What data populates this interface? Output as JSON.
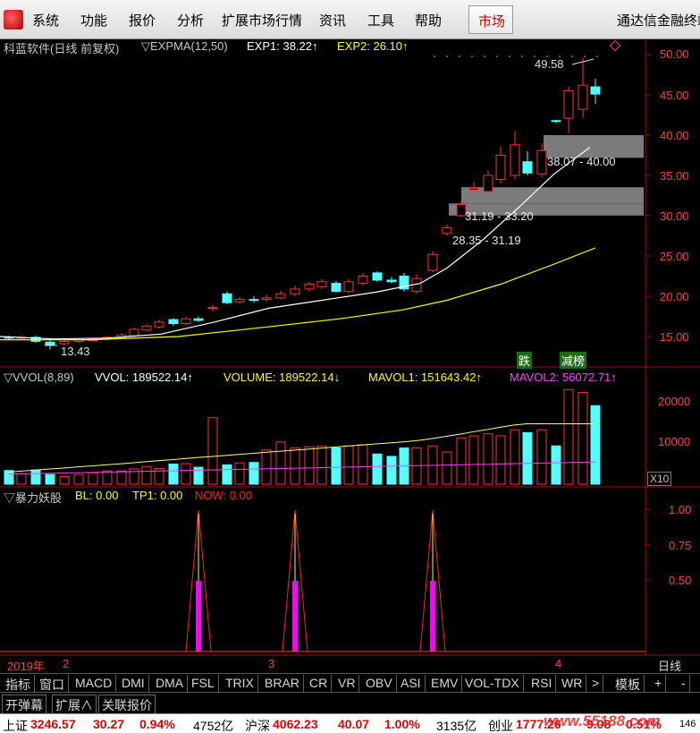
{
  "menu": {
    "items": [
      "系统",
      "功能",
      "报价",
      "分析",
      "扩展市场行情",
      "资讯",
      "工具",
      "帮助"
    ],
    "market_label": "市场",
    "brand": "通达信金融终端"
  },
  "main_panel": {
    "title": "科蓝软件(日线 前复权)",
    "indicator": "▽EXPMA(12,50)",
    "exp1": "EXP1: 38.22↑",
    "exp2": "EXP2: 26.10↑",
    "price_high_label": "49.58",
    "price_low_label": "13.43",
    "zone_labels": [
      "38.07 - 40.00",
      "31.19 - 33.20",
      "28.35 - 31.19"
    ],
    "tags": {
      "down": "跌",
      "reduce": "减榜"
    },
    "y_ticks": [
      "50.00",
      "45.00",
      "40.00",
      "35.00",
      "30.00",
      "25.00",
      "20.00",
      "15.00"
    ],
    "colors": {
      "up": "#ff3232",
      "down": "#54ffff",
      "exp1": "#ffffff",
      "exp2": "#ffff00"
    }
  },
  "vol_panel": {
    "indicator": "▽VVOL(8,89)",
    "vvol": "VVOL: 189522.14↑",
    "volume": "VOLUME: 189522.14↓",
    "mavol1": "MAVOL1: 151643.42↑",
    "mavol2": "MAVOL2: 56072.71↑",
    "y_ticks": [
      "20000",
      "10000"
    ],
    "unit": "X10"
  },
  "sub_panel": {
    "indicator": "▽暴力妖股",
    "bl": "BL: 0.00",
    "tp1": "TP1: 0.00",
    "now": "NOW: 0.00",
    "y_ticks": [
      "1.00",
      "0.75",
      "0.50"
    ]
  },
  "date_axis": {
    "year": "2019年",
    "months": [
      "2",
      "3",
      "4"
    ],
    "cycle": "日线"
  },
  "tabs": [
    "指标",
    "窗口",
    "MACD",
    "DMI",
    "DMA",
    "FSL",
    "TRIX",
    "BRAR",
    "CR",
    "VR",
    "OBV",
    "ASI",
    "EMV",
    "VOL-TDX",
    "RSI",
    "WR",
    ">",
    "模板",
    "+",
    "-"
  ],
  "toolbar2": [
    "开弹幕",
    "扩展∧",
    "关联报价"
  ],
  "status": {
    "sh_label": "上证",
    "sh_value": "3246.57",
    "sh_change": "30.27",
    "sh_pct": "0.94%",
    "sh_amount": "4752亿",
    "hs_label": "沪深",
    "hs_value": "4062.23",
    "hs_change": "40.07",
    "hs_pct": "1.00%",
    "hs_amount": "3135亿",
    "cy_label": "创业",
    "cy_value": "1777.26",
    "cy_change": "9.08",
    "cy_pct": "0.51%",
    "cy_amount": "146",
    "watermark": "www.55188.com"
  }
}
